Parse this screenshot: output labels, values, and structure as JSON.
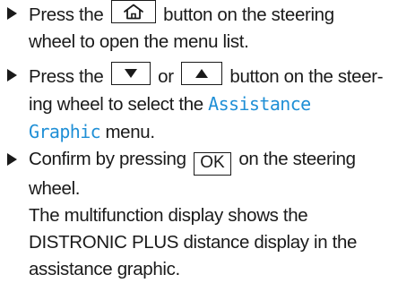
{
  "steps": [
    {
      "before": "Press the",
      "key_icon": "home-icon",
      "after_line1": "button on the steering",
      "line2": "wheel to open the menu list."
    },
    {
      "before": "Press the",
      "key1_icon": "down-triangle-icon",
      "or": "or",
      "key2_icon": "up-triangle-icon",
      "after_line1": "button on the steer-",
      "line2_before": "ing wheel to select the",
      "menu_name_part1": "Assistance",
      "menu_name_part2": "Graphic",
      "line3_after": "menu."
    },
    {
      "before": "Confirm by pressing",
      "key_label": "OK",
      "after_line1": "on the steering",
      "line2": "wheel.",
      "result_line1": "The multifunction display shows the",
      "result_line2": "DISTRONIC PLUS distance display in the",
      "result_line3": "assistance graphic."
    }
  ],
  "colors": {
    "text": "#1a1a1a",
    "menu_name": "#1f8fd6"
  }
}
